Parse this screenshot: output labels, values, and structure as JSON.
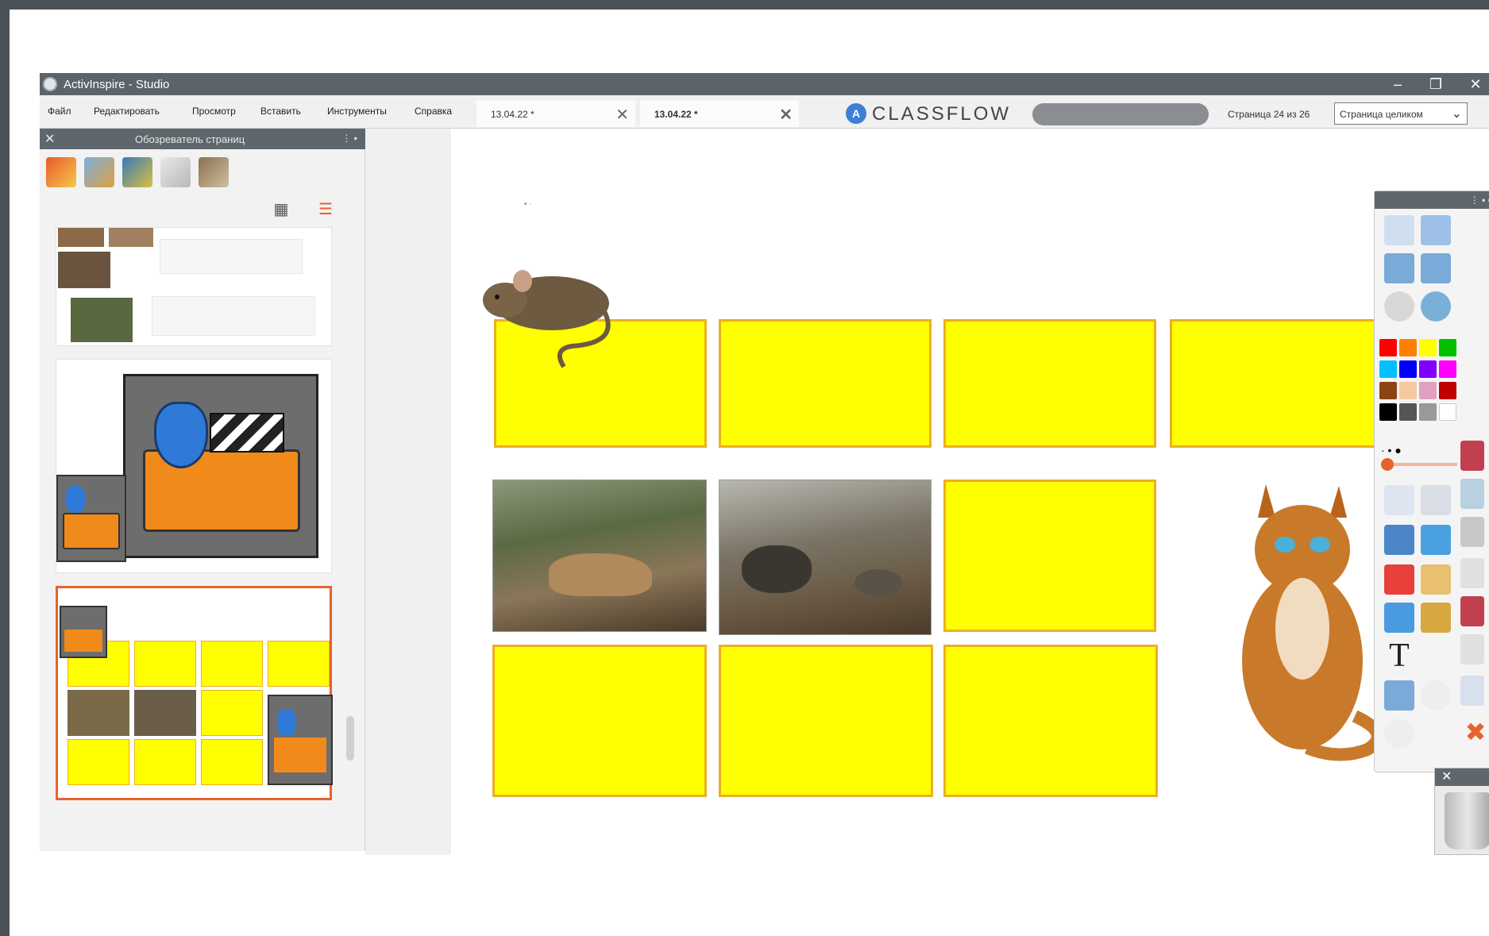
{
  "window": {
    "title": "ActivInspire - Studio",
    "minimize": "–",
    "restore": "❐",
    "close": "✕"
  },
  "menu": [
    "Файл",
    "Редактировать",
    "Просмотр",
    "Вставить",
    "Инструменты",
    "Справка"
  ],
  "tabs": [
    {
      "label": "13.04.22 *",
      "active": false
    },
    {
      "label": "13.04.22 *",
      "active": true
    }
  ],
  "tab_close": "✕",
  "classflow": {
    "icon": "A",
    "logo": "CLASSFLOW"
  },
  "page_info": "Страница 24 из 26",
  "zoom": {
    "value": "Страница целиком",
    "chevron": "⌄"
  },
  "page_browser": {
    "title": "Обозреватель страниц",
    "close": "✕",
    "pin": "⋮ ▪",
    "grid_icon": "▦",
    "list_icon": "☰"
  },
  "toolbox": {
    "header": "⋮ ▪ ▪",
    "text_tool": "T",
    "delete_icon": "✖"
  },
  "trash": {
    "close": "✕"
  },
  "colors": {
    "accent": "#e8622c",
    "card_fill": "#ffff00",
    "card_border": "#ecae28",
    "palette": [
      "#ff0000",
      "#ff8000",
      "#ffff00",
      "#00c000",
      "#00c0ff",
      "#0000ff",
      "#8000ff",
      "#ff00ff",
      "#8b4513",
      "#f5c9a0",
      "#e0a0c0",
      "#c00000",
      "#000000",
      "#555555",
      "#999999",
      "#ffffff"
    ]
  }
}
